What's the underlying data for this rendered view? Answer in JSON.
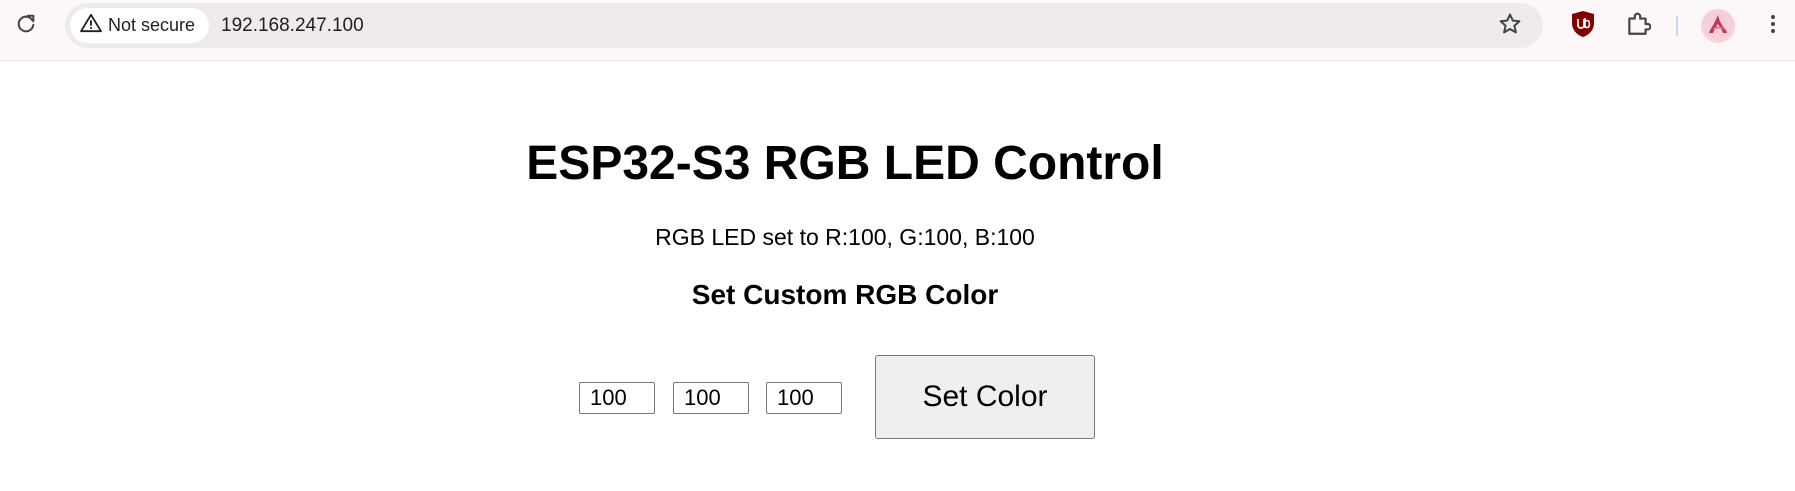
{
  "browser": {
    "security_label": "Not secure",
    "url": "192.168.247.100",
    "icons": [
      "reload-icon",
      "warning-icon",
      "bookmark-star-icon",
      "ublock-icon",
      "extensions-icon",
      "profile-avatar-icon",
      "kebab-menu-icon"
    ],
    "colors": {
      "toolbar_bg": "#fcf7f8",
      "omnibox_bg": "#efeaec",
      "ublock_red": "#800000",
      "divider_blue": "#c7d7f5"
    }
  },
  "page": {
    "title": "ESP32-S3 RGB LED Control",
    "status": "RGB LED set to R:100, G:100, B:100",
    "form_heading": "Set Custom RGB Color",
    "inputs": {
      "red": "100",
      "green": "100",
      "blue": "100"
    },
    "submit_label": "Set Color"
  }
}
